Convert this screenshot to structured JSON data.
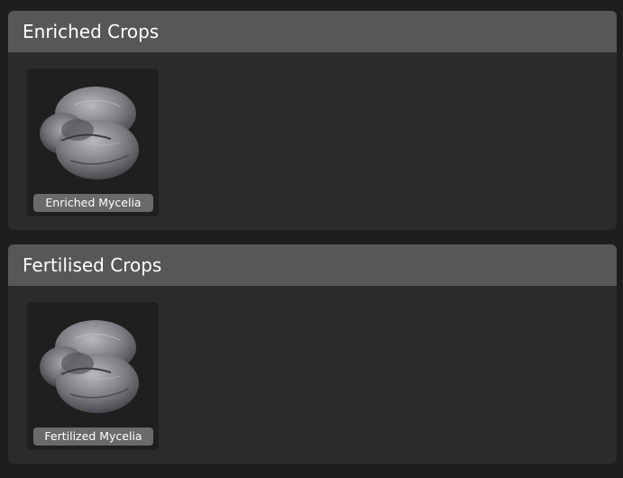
{
  "sections": [
    {
      "title": "Enriched Crops",
      "items": [
        {
          "label": "Enriched Mycelia",
          "icon": "mycelia-icon"
        }
      ]
    },
    {
      "title": "Fertilised Crops",
      "items": [
        {
          "label": "Fertilized Mycelia",
          "icon": "mycelia-icon"
        }
      ]
    }
  ],
  "colors": {
    "background": "#1e1e1e",
    "panel": "#2b2b2b",
    "header": "#575757",
    "tile": "#1f1f1f",
    "label_pill": "#6a6a6a"
  }
}
